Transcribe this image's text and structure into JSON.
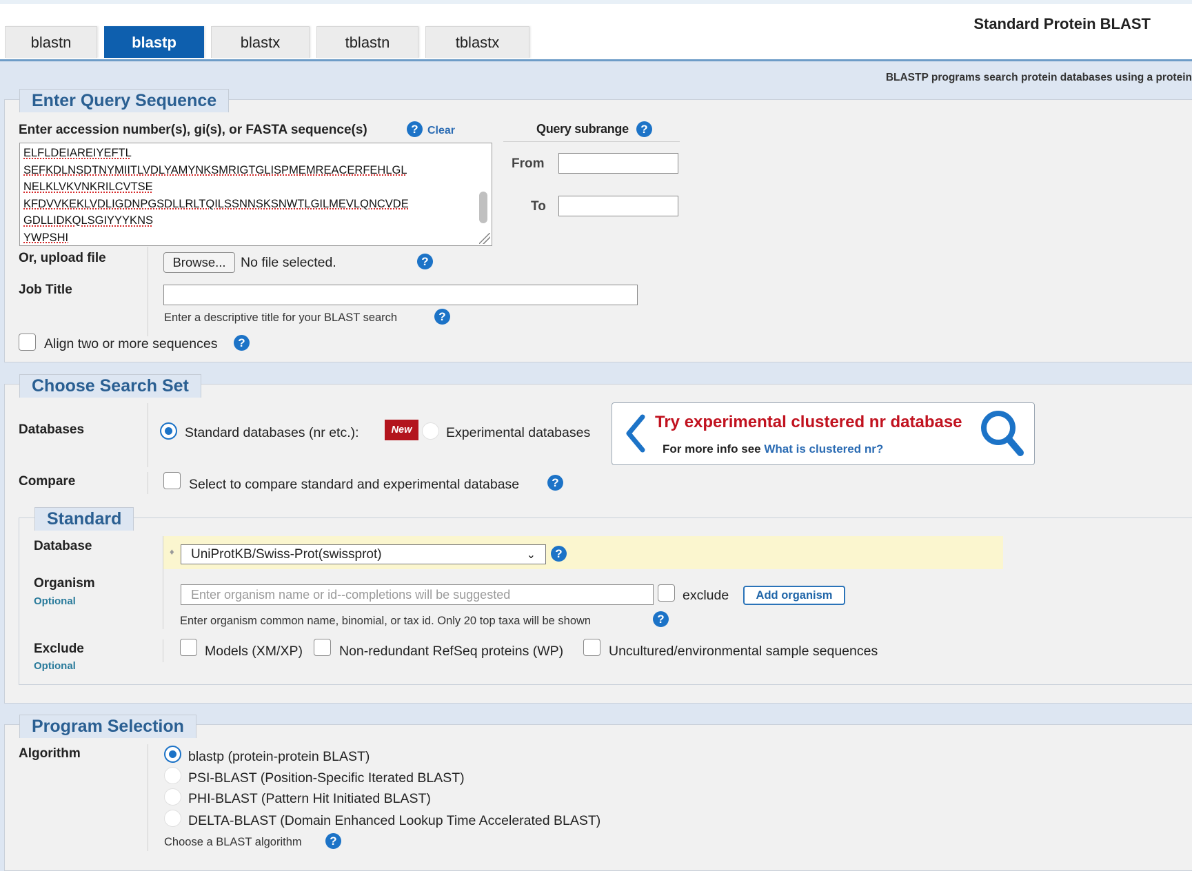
{
  "page": {
    "title": "Standard Protein BLAST",
    "subtitle": "BLASTP programs search protein databases using a protein"
  },
  "tabs": [
    {
      "label": "blastn",
      "active": false
    },
    {
      "label": "blastp",
      "active": true
    },
    {
      "label": "blastx",
      "active": false
    },
    {
      "label": "tblastn",
      "active": false
    },
    {
      "label": "tblastx",
      "active": false
    }
  ],
  "query": {
    "legend": "Enter Query Sequence",
    "input_label": "Enter accession number(s), gi(s), or FASTA sequence(s)",
    "clear_label": "Clear",
    "sequence_lines": [
      "ELFLDEIAREIYEFTL",
      "SEFKDLNSDTNYMIITLVDLYAMYNKSMRIGTGLISPMEMREACERFEHLGL",
      "NELKLVKVNKRILCVTSE",
      "KFDVVKEKLVDLIGDNPGSDLLRLTQILSSNNSKSNWTLGILMEVLQNCVDE",
      "GDLLIDKQLSGIYYYKNS",
      "YWPSHI"
    ],
    "subrange_title": "Query subrange",
    "from_label": "From",
    "from_value": "",
    "to_label": "To",
    "to_value": "",
    "upload_label": "Or, upload file",
    "browse_label": "Browse...",
    "no_file_text": "No file selected.",
    "job_title_label": "Job Title",
    "job_title_value": "",
    "job_title_hint": "Enter a descriptive title for your BLAST search",
    "align_label": "Align two or more sequences",
    "align_checked": false
  },
  "search_set": {
    "legend": "Choose Search Set",
    "databases_label": "Databases",
    "standard_db_label": "Standard databases (nr etc.):",
    "new_badge": "New",
    "experimental_db_label": "Experimental databases",
    "selected_db": "standard",
    "promo_title": "Try experimental clustered nr database",
    "promo_sub_prefix": "For more info see",
    "promo_link": "What is clustered nr?",
    "compare_label": "Compare",
    "compare_checkbox_label": "Select to compare standard and experimental database",
    "standard": {
      "legend": "Standard",
      "database_label": "Database",
      "database_value": "UniProtKB/Swiss-Prot(swissprot)",
      "organism_label": "Organism",
      "optional_label": "Optional",
      "organism_placeholder": "Enter organism name or id--completions will be suggested",
      "exclude_checkbox_label": "exclude",
      "add_organism_label": "Add organism",
      "organism_hint": "Enter organism common name, binomial, or tax id. Only 20 top taxa will be shown",
      "exclude_label": "Exclude",
      "exclude_options": [
        "Models (XM/XP)",
        "Non-redundant RefSeq proteins (WP)",
        "Uncultured/environmental sample sequences"
      ]
    }
  },
  "program": {
    "legend": "Program Selection",
    "algorithm_label": "Algorithm",
    "options": [
      "blastp (protein-protein BLAST)",
      "PSI-BLAST (Position-Specific Iterated BLAST)",
      "PHI-BLAST (Pattern Hit Initiated BLAST)",
      "DELTA-BLAST (Domain Enhanced Lookup Time Accelerated BLAST)"
    ],
    "selected_index": 0,
    "hint": "Choose a BLAST algorithm"
  },
  "icons": {
    "help": "?",
    "chevron": "chevron-left-icon",
    "search": "search-icon"
  },
  "colors": {
    "active_tab": "#0e5fae",
    "legend_text": "#2a5f92",
    "promo_title": "#c1121f",
    "new_badge": "#b3141d",
    "help_icon": "#1c73c7"
  }
}
